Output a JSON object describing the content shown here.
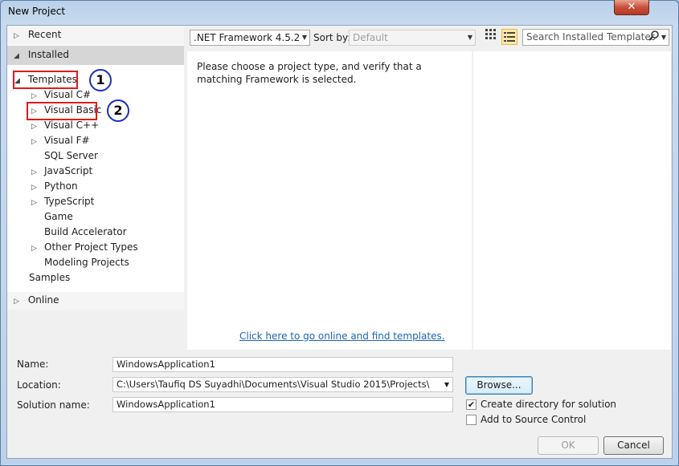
{
  "window": {
    "title": "New Project",
    "close_glyph": "✕"
  },
  "tree": {
    "recent": "Recent",
    "installed": "Installed",
    "templates": "Templates",
    "items": [
      {
        "label": "Visual C#",
        "expandable": true
      },
      {
        "label": "Visual Basic",
        "expandable": true
      },
      {
        "label": "Visual C++",
        "expandable": true
      },
      {
        "label": "Visual F#",
        "expandable": true
      },
      {
        "label": "SQL Server",
        "expandable": false
      },
      {
        "label": "JavaScript",
        "expandable": true
      },
      {
        "label": "Python",
        "expandable": true
      },
      {
        "label": "TypeScript",
        "expandable": true
      },
      {
        "label": "Game",
        "expandable": false
      },
      {
        "label": "Build Accelerator",
        "expandable": false
      },
      {
        "label": "Other Project Types",
        "expandable": true
      },
      {
        "label": "Modeling Projects",
        "expandable": false
      }
    ],
    "samples": "Samples",
    "online": "Online"
  },
  "toolbar": {
    "framework": ".NET Framework 4.5.2",
    "sort_label": "Sort by:",
    "sort_value": "Default",
    "search_placeholder": "Search Installed Templates"
  },
  "main": {
    "message": "Please choose a project type, and verify that a matching Framework is selected.",
    "online_link": "Click here to go online and find templates."
  },
  "form": {
    "name_label": "Name:",
    "name_value": "WindowsApplication1",
    "location_label": "Location:",
    "location_value": "C:\\Users\\Taufiq DS Suyadhi\\Documents\\Visual Studio 2015\\Projects\\",
    "solution_label": "Solution name:",
    "solution_value": "WindowsApplication1",
    "browse": "Browse...",
    "create_dir": "Create directory for solution",
    "create_dir_checked": true,
    "add_source": "Add to Source Control",
    "add_source_checked": false,
    "ok": "OK",
    "cancel": "Cancel"
  },
  "annotations": {
    "one": "1",
    "two": "2"
  },
  "icons": {
    "collapsed": "▷",
    "expanded": "◢",
    "dropdown": "▼",
    "grid_view": "grid-view-icon",
    "list_view": "list-view-icon",
    "search": "search-icon"
  },
  "colors": {
    "annotation_red": "#e11b1b",
    "annotation_blue": "#1a2fc0",
    "link": "#1b64b8"
  }
}
